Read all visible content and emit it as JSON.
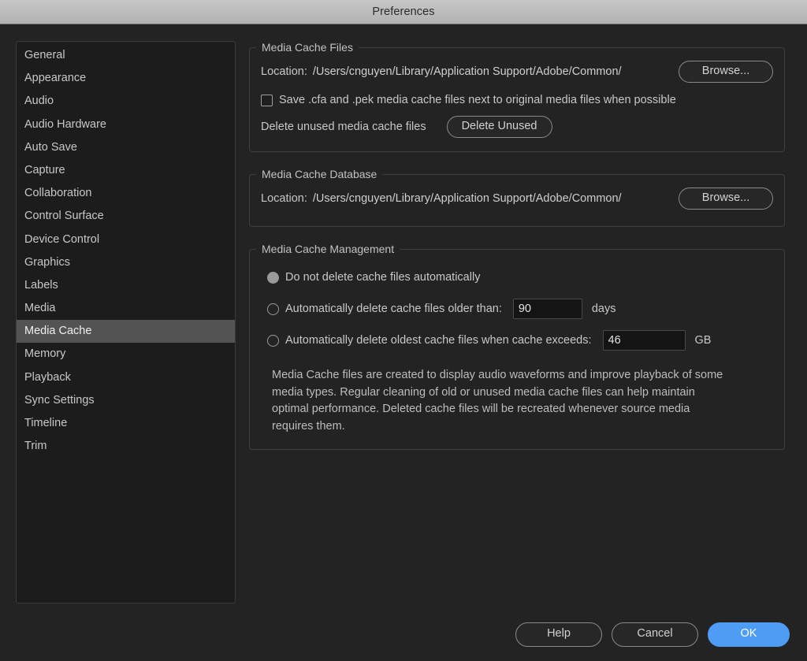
{
  "window": {
    "title": "Preferences"
  },
  "sidebar": {
    "items": [
      {
        "label": "General",
        "selected": false
      },
      {
        "label": "Appearance",
        "selected": false
      },
      {
        "label": "Audio",
        "selected": false
      },
      {
        "label": "Audio Hardware",
        "selected": false
      },
      {
        "label": "Auto Save",
        "selected": false
      },
      {
        "label": "Capture",
        "selected": false
      },
      {
        "label": "Collaboration",
        "selected": false
      },
      {
        "label": "Control Surface",
        "selected": false
      },
      {
        "label": "Device Control",
        "selected": false
      },
      {
        "label": "Graphics",
        "selected": false
      },
      {
        "label": "Labels",
        "selected": false
      },
      {
        "label": "Media",
        "selected": false
      },
      {
        "label": "Media Cache",
        "selected": true
      },
      {
        "label": "Memory",
        "selected": false
      },
      {
        "label": "Playback",
        "selected": false
      },
      {
        "label": "Sync Settings",
        "selected": false
      },
      {
        "label": "Timeline",
        "selected": false
      },
      {
        "label": "Trim",
        "selected": false
      }
    ]
  },
  "media_cache_files": {
    "legend": "Media Cache Files",
    "location_label": "Location:",
    "location_path": "/Users/cnguyen/Library/Application Support/Adobe/Common/",
    "browse_label": "Browse...",
    "save_next_to_original_label": "Save .cfa and .pek media cache files next to original media files when possible",
    "save_next_to_original_checked": false,
    "delete_unused_label": "Delete unused media cache files",
    "delete_unused_button": "Delete Unused"
  },
  "media_cache_database": {
    "legend": "Media Cache Database",
    "location_label": "Location:",
    "location_path": "/Users/cnguyen/Library/Application Support/Adobe/Common/",
    "browse_label": "Browse..."
  },
  "media_cache_management": {
    "legend": "Media Cache Management",
    "option_none_label": "Do not delete cache files automatically",
    "option_none_selected": true,
    "option_older_label": "Automatically delete cache files older than:",
    "option_older_selected": false,
    "older_value": "90",
    "older_unit": "days",
    "option_exceeds_label": "Automatically delete oldest cache files when cache exceeds:",
    "option_exceeds_selected": false,
    "exceeds_value": "46",
    "exceeds_unit": "GB",
    "description": "Media Cache files are created to display audio waveforms and improve playback of some media types.  Regular cleaning of old or unused media cache files can help maintain optimal performance. Deleted cache files will be recreated whenever source media requires them."
  },
  "footer": {
    "help_label": "Help",
    "cancel_label": "Cancel",
    "ok_label": "OK",
    "ok_color": "#4f9cf5"
  }
}
